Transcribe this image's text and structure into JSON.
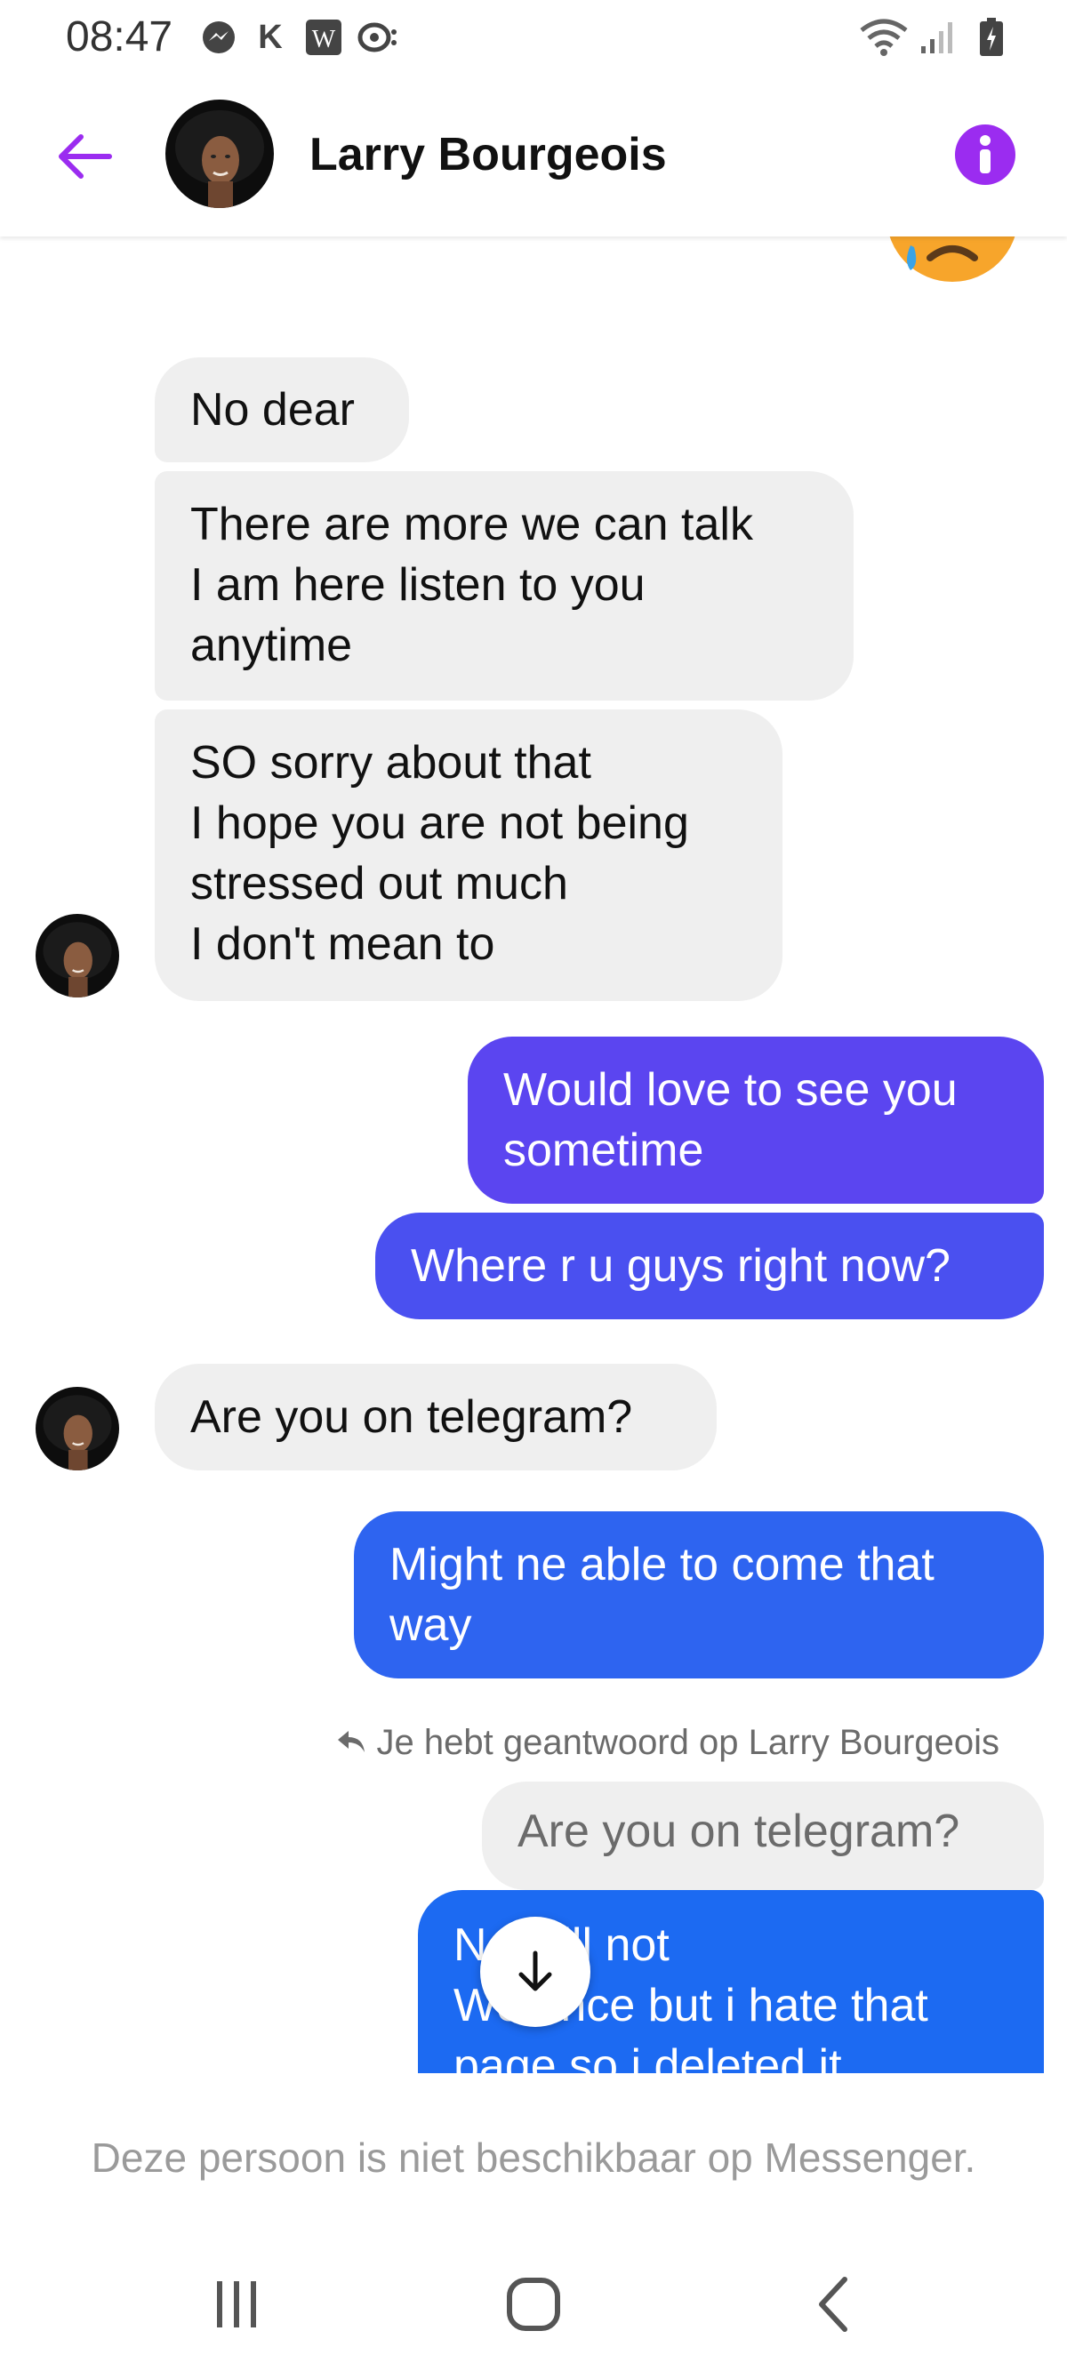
{
  "status_bar": {
    "time": "08:47",
    "letter": "K",
    "icons": [
      "messenger-icon",
      "k-icon",
      "wordfeud-icon",
      "chat-notification-icon",
      "wifi-icon",
      "signal-icon",
      "battery-icon"
    ]
  },
  "header": {
    "contact_name": "Larry Bourgeois",
    "accent_color": "#9b2cf0",
    "icons": [
      "back-arrow-icon",
      "info-icon"
    ]
  },
  "messages": [
    {
      "side": "in",
      "text": "No dear"
    },
    {
      "side": "in",
      "text": "There are more we can talk\nI am here listen to you\nanytime"
    },
    {
      "side": "in",
      "text": "SO sorry about that\nI hope you are not being\nstressed out much\n I don't mean to"
    },
    {
      "side": "out",
      "text": "Would love to see you\nsometime",
      "color": "#5b45f0"
    },
    {
      "side": "out",
      "text": "Where r u guys right now?",
      "color": "#4a50f0"
    },
    {
      "side": "in",
      "text": "Are you on telegram?"
    },
    {
      "side": "out",
      "text": "Might ne able to come that\nway",
      "color": "#2e64f0"
    },
    {
      "side": "reply-quote",
      "text": "Are you on telegram?"
    },
    {
      "side": "out",
      "text": "No still not\nWe once but i hate that\npage so i deleted it",
      "color": "#1c6af2"
    }
  ],
  "reply_note": "Je hebt geantwoord op Larry Bourgeois",
  "footer": {
    "unavailable_text": "Deze persoon is niet beschikbaar op Messenger."
  },
  "navbar": {
    "icons": [
      "recent-apps-icon",
      "home-icon",
      "back-icon"
    ]
  }
}
